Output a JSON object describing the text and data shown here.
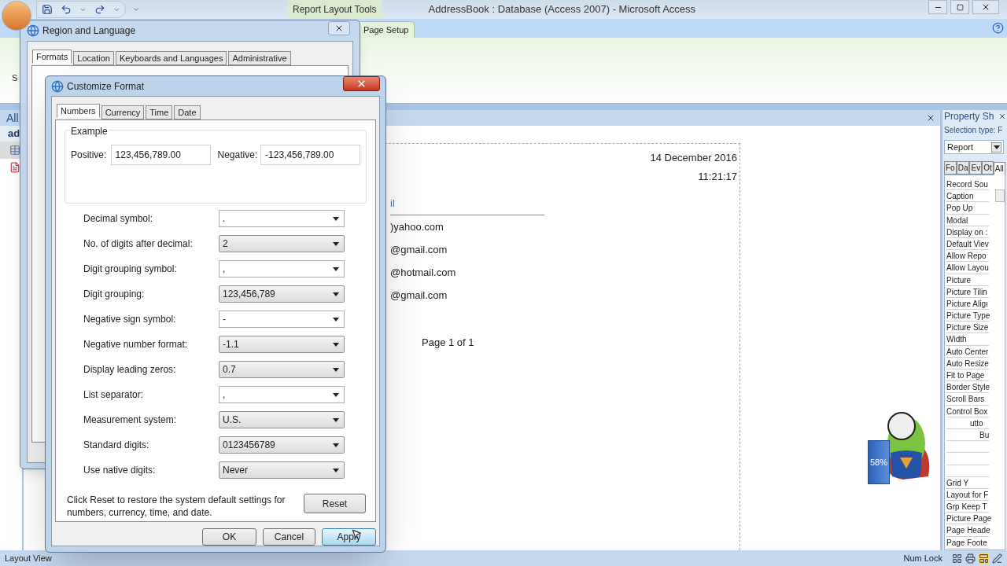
{
  "window": {
    "title": "AddressBook : Database (Access 2007) - Microsoft Access",
    "contextual_label": "Report Layout Tools"
  },
  "ribbon": {
    "tabs": [
      {
        "label": "Page Setup",
        "selected": true
      }
    ],
    "fragment": "S"
  },
  "navigation_pane": {
    "header": "All",
    "group": "ad"
  },
  "report": {
    "date": "14 December 2016",
    "time": "11:21:17",
    "column_header": "il",
    "rows": [
      ")yahoo.com",
      "@gmail.com",
      "@hotmail.com",
      "@gmail.com"
    ],
    "footer": "Page 1 of 1"
  },
  "property_sheet": {
    "title": "Property Sh",
    "selection_label": "Selection type: F",
    "selector": "Report",
    "tabs": [
      {
        "label": "Fo",
        "selected": false
      },
      {
        "label": "Da",
        "selected": false
      },
      {
        "label": "Ev",
        "selected": false
      },
      {
        "label": "Ot",
        "selected": false
      },
      {
        "label": "All",
        "selected": true
      }
    ],
    "items_top": [
      "Record Sou",
      "Caption",
      "Pop Up",
      "Modal",
      "Display on :",
      "Default Viev",
      "Allow Repo",
      "Allow Layou",
      "Picture",
      "Picture Tilin",
      "Picture Aligı",
      "Picture Type",
      "Picture Size",
      "Width",
      "Auto Center",
      "Auto Resize",
      "Fit to Page",
      "Border Style",
      "Scroll Bars",
      "Control Box"
    ],
    "items_partial": [
      "utto",
      "Bu"
    ],
    "items_bottom": [
      "Grid Y",
      "Layout for F",
      "Grp Keep T",
      "Picture Page",
      "Page Heade",
      "Page Foote"
    ]
  },
  "monitor_widget": {
    "reading": "58%"
  },
  "region_dialog": {
    "title": "Region and Language",
    "tabs": [
      {
        "label": "Formats",
        "selected": true
      },
      {
        "label": "Location",
        "selected": false
      },
      {
        "label": "Keyboards and Languages",
        "selected": false
      },
      {
        "label": "Administrative",
        "selected": false
      }
    ]
  },
  "customize_dialog": {
    "title": "Customize Format",
    "tabs": [
      {
        "label": "Numbers",
        "selected": true
      },
      {
        "label": "Currency",
        "selected": false
      },
      {
        "label": "Time",
        "selected": false
      },
      {
        "label": "Date",
        "selected": false
      }
    ],
    "example": {
      "legend": "Example",
      "positive_label": "Positive:",
      "positive": "123,456,789.00",
      "negative_label": "Negative:",
      "negative": "-123,456,789.00"
    },
    "settings": [
      {
        "label": "Decimal symbol:",
        "value": ".",
        "kind": "edit"
      },
      {
        "label": "No. of digits after decimal:",
        "value": "2",
        "kind": "list"
      },
      {
        "label": "Digit grouping symbol:",
        "value": ",",
        "kind": "edit"
      },
      {
        "label": "Digit grouping:",
        "value": "123,456,789",
        "kind": "list"
      },
      {
        "label": "Negative sign symbol:",
        "value": "-",
        "kind": "edit"
      },
      {
        "label": "Negative number format:",
        "value": "-1.1",
        "kind": "list"
      },
      {
        "label": "Display leading zeros:",
        "value": "0.7",
        "kind": "list"
      },
      {
        "label": "List separator:",
        "value": ",",
        "kind": "edit"
      },
      {
        "label": "Measurement system:",
        "value": "U.S.",
        "kind": "list"
      },
      {
        "label": "Standard digits:",
        "value": "0123456789",
        "kind": "list"
      },
      {
        "label": "Use native digits:",
        "value": "Never",
        "kind": "list"
      }
    ],
    "note": "Click Reset to restore the system default settings for numbers, currency, time, and date.",
    "reset": "Reset",
    "buttons": [
      "OK",
      "Cancel",
      "Apply"
    ]
  },
  "status_bar": {
    "left": "Layout View",
    "right": "Num Lock"
  }
}
